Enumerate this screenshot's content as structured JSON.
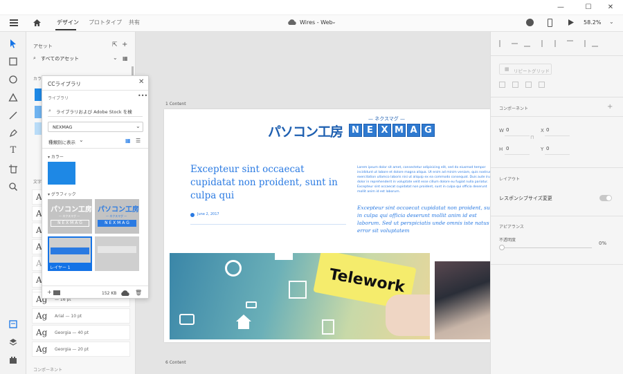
{
  "window": {
    "minimize": "—",
    "maximize": "☐",
    "close": "✕"
  },
  "header": {
    "tabs": [
      {
        "label": "デザイン"
      },
      {
        "label": "プロトタイプ"
      },
      {
        "label": "共有"
      }
    ],
    "doc_title": "Wires - Web",
    "zoom": "58.2%"
  },
  "assets": {
    "title": "アセット",
    "dropdown": "すべてのアセット",
    "colors_label": "カラー",
    "text_label": "文字",
    "fonts": [
      {
        "ag": "Ag",
        "label": ""
      },
      {
        "ag": "Ag",
        "label": ""
      },
      {
        "ag": "Ag",
        "label": ""
      },
      {
        "ag": "Ag",
        "label": ""
      },
      {
        "ag": "Ag",
        "label": ""
      },
      {
        "ag": "Ag",
        "label": ""
      },
      {
        "ag": "Ag",
        "label": ""
      },
      {
        "ag": "Ag",
        "label": "— 16 pt"
      },
      {
        "ag": "Ag",
        "label": "Arial — 10 pt"
      },
      {
        "ag": "Ag",
        "label": "Georgia — 40 pt"
      },
      {
        "ag": "Ag",
        "label": "Georgia — 20 pt"
      }
    ],
    "components_label": "コンポーネント"
  },
  "cc": {
    "title": "CCライブラリ",
    "libraries_label": "ライブラリ",
    "search_placeholder": "ライブラリおよび Adobe Stock を検",
    "library": "NEXMAG",
    "view_by": "種類別に表示",
    "colors_section": "カラー",
    "graphics_section": "グラフィック",
    "graphics": [
      {
        "jp": "パソコン工房",
        "sub": "— ネクスマグ —",
        "en": "N E X M A G"
      },
      {
        "jp": "パソコン工房",
        "sub": "— ネクスマグ —",
        "en": "N E X M A G"
      }
    ],
    "layer_label": "レイヤー 1",
    "size": "152 KB",
    "accent": "#1e88e5"
  },
  "canvas": {
    "label_top": "1 Content",
    "label_bottom": "6 Content"
  },
  "article": {
    "logo_jp": "パソコン工房",
    "logo_sub": "— ネクスマグ —",
    "logo_en": [
      "N",
      "E",
      "X",
      "M",
      "A",
      "G"
    ],
    "headline": "Excepteur sint occaecat cupidatat non proident, sunt in culpa qui",
    "date": "June 2, 2017",
    "body": "Lorem ipsum dolor sit amet, consectetur adipisicing elit, sed do eiusmod tempor incididunt ut labore et dolore magna aliqua. Ut enim ad minim veniam, quis nostrud exercitation ullamco laboris nisi ut aliquip ex ea commodo consequat. Duis aute irure dolor in reprehenderit in voluptate velit esse cillum dolore eu fugiat nulla pariatur. Excepteur sint occaecat cupidatat non proident, sunt in culpa qui officia deserunt mollit anim id est laborum.",
    "quote": "Excepteur sint occaecat cupidatat non proident, sunt in culpa qui officia deserunt mollit anim id est laborum. Sed ut perspiciatis unde omnis iste natus error sit voluptatem",
    "banner_text": "Telework"
  },
  "props": {
    "repeat_grid": "リピートグリッド",
    "component": "コンポーネント",
    "w_label": "W",
    "w_value": "0",
    "x_label": "X",
    "x_value": "0",
    "h_label": "H",
    "h_value": "0",
    "y_label": "Y",
    "y_value": "0",
    "layout": "レイアウト",
    "responsive": "レスポンシブサイズ変更",
    "appearance": "アピアランス",
    "opacity_label": "不透明度",
    "opacity_value": "0%"
  },
  "colors": {
    "brand_blue": "#1e5fb0",
    "link_blue": "#2a7ae2",
    "selection": "#1473e6"
  }
}
